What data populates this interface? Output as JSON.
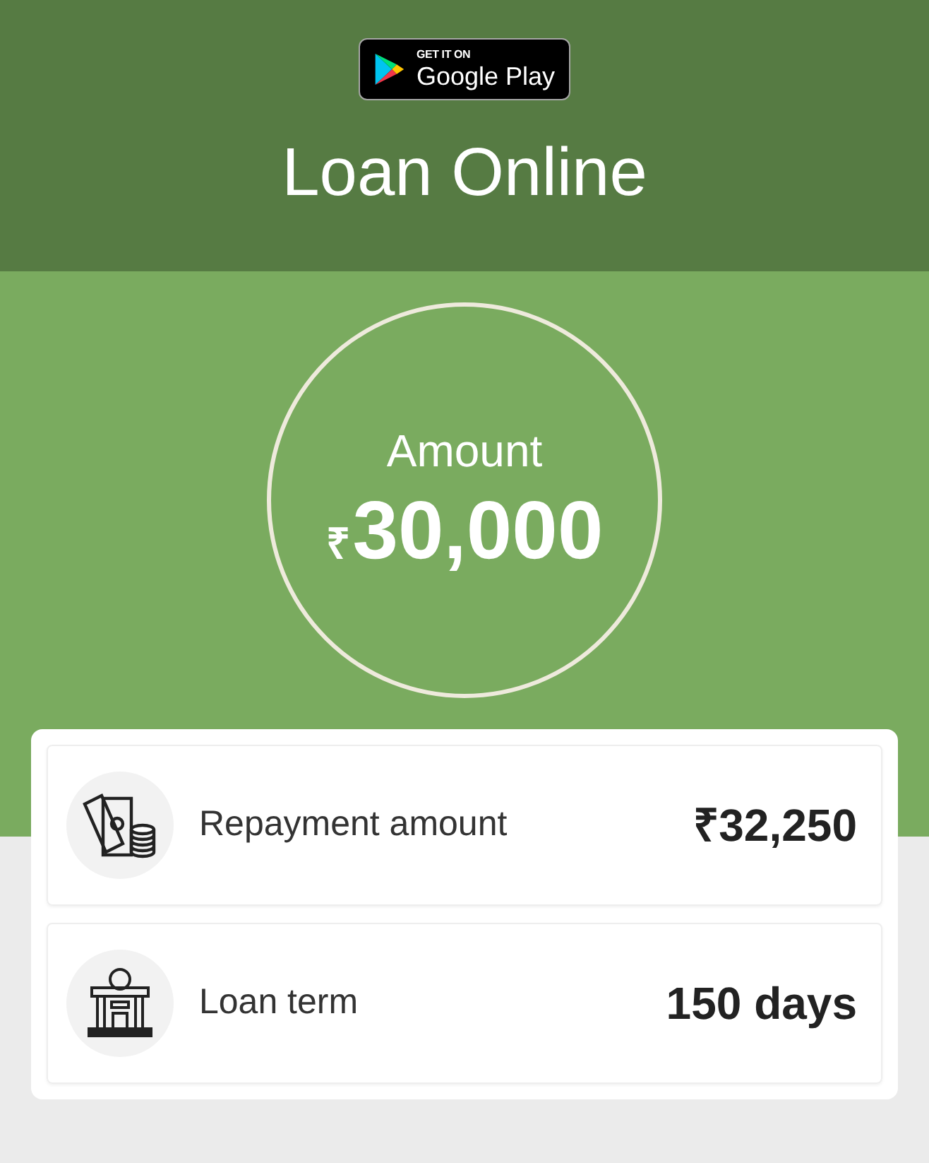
{
  "store_badge": {
    "small_text": "GET IT ON",
    "store_name": "Google Play"
  },
  "title": "Loan Online",
  "amount": {
    "label": "Amount",
    "currency": "₹",
    "value": "30,000"
  },
  "details": [
    {
      "kind": "money",
      "label": "Repayment amount",
      "value": "₹32,250"
    },
    {
      "kind": "bank",
      "label": "Loan term",
      "value": "150 days"
    }
  ]
}
